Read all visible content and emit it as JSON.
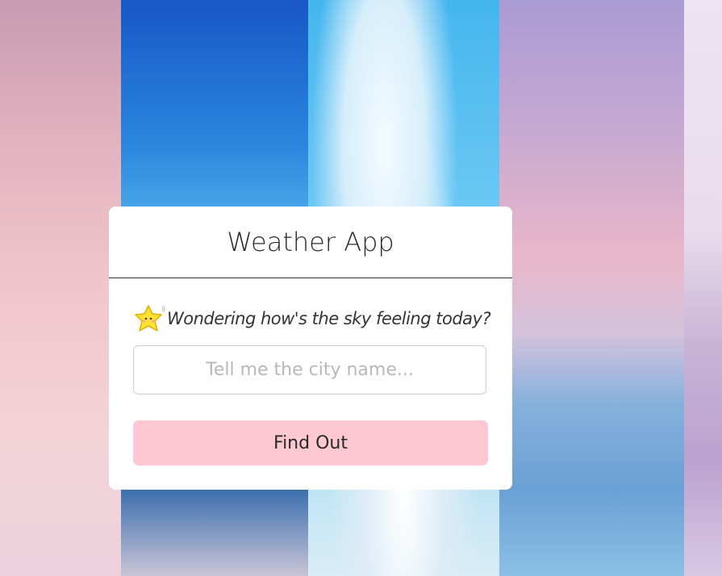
{
  "app": {
    "title": "Weather App",
    "tagline": "Wondering how's the sky feeling today?",
    "tagline_icon": "star-emoji-icon",
    "search": {
      "value": "",
      "placeholder": "Tell me the city name..."
    },
    "submit_label": "Find Out"
  },
  "colors": {
    "button_bg": "#fdc8d2",
    "card_bg": "#ffffff"
  }
}
